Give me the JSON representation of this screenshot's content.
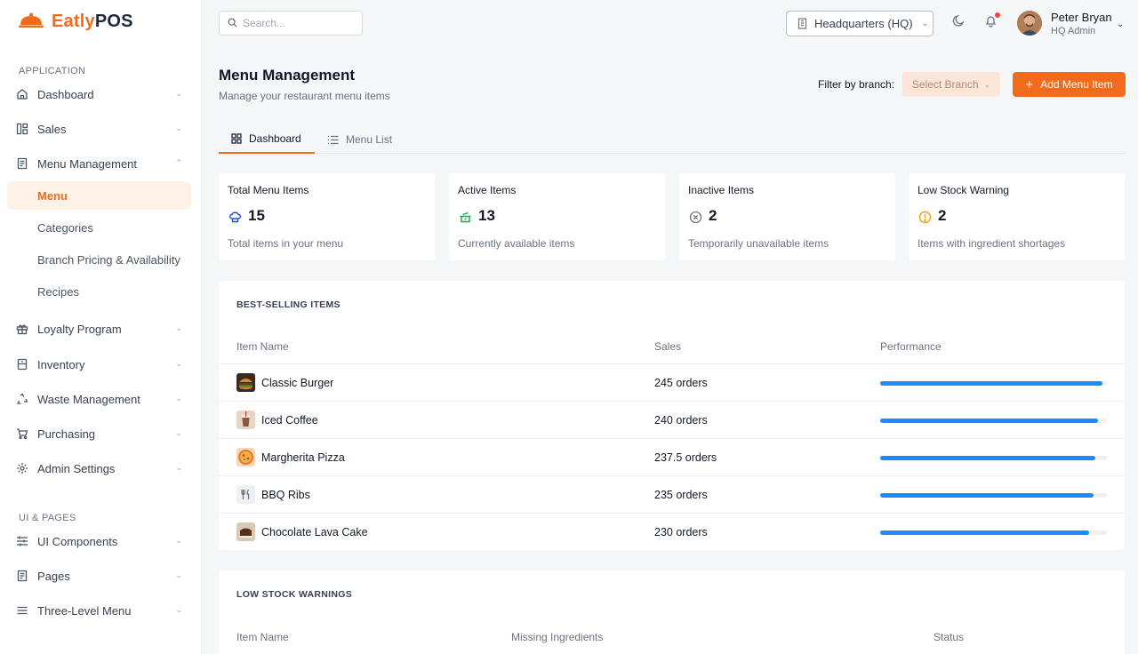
{
  "brand": {
    "name_part1": "Eatly",
    "name_part2": "POS",
    "logo_icon": "cloche-icon",
    "accent": "#f26b1d"
  },
  "sidebar": {
    "section_app": "APPLICATION",
    "section_ui": "UI & PAGES",
    "items": [
      {
        "label": "Dashboard",
        "icon": "home-icon"
      },
      {
        "label": "Sales",
        "icon": "grid-icon"
      },
      {
        "label": "Menu Management",
        "icon": "receipt-icon"
      },
      {
        "label": "Loyalty Program",
        "icon": "gift-icon"
      },
      {
        "label": "Inventory",
        "icon": "box-icon"
      },
      {
        "label": "Waste Management",
        "icon": "recycle-icon"
      },
      {
        "label": "Purchasing",
        "icon": "cart-icon"
      },
      {
        "label": "Admin Settings",
        "icon": "gear-icon"
      }
    ],
    "menu_sub": [
      {
        "label": "Menu",
        "active": true
      },
      {
        "label": "Categories"
      },
      {
        "label": "Branch Pricing & Availability"
      },
      {
        "label": "Recipes"
      }
    ],
    "ui_items": [
      {
        "label": "UI Components",
        "icon": "sliders-icon"
      },
      {
        "label": "Pages",
        "icon": "pages-icon"
      },
      {
        "label": "Three-Level Menu",
        "icon": "menu-lines-icon"
      }
    ]
  },
  "topbar": {
    "search_placeholder": "Search...",
    "branch": "Headquarters (HQ)",
    "user_name": "Peter Bryan",
    "user_role": "HQ Admin"
  },
  "page": {
    "title": "Menu Management",
    "subtitle": "Manage your restaurant menu items",
    "filter_label": "Filter by branch:",
    "filter_placeholder": "Select Branch",
    "add_button": "Add Menu Item"
  },
  "tabs": [
    {
      "label": "Dashboard",
      "active": true,
      "icon": "dashboard-icon"
    },
    {
      "label": "Menu List",
      "active": false,
      "icon": "list-icon"
    }
  ],
  "stats": [
    {
      "label": "Total Menu Items",
      "value": "15",
      "desc": "Total items in your menu",
      "icon": "chef-hat-icon",
      "color": "#1d4ed8"
    },
    {
      "label": "Active Items",
      "value": "13",
      "desc": "Currently available items",
      "icon": "pot-icon",
      "color": "#16a34a"
    },
    {
      "label": "Inactive Items",
      "value": "2",
      "desc": "Temporarily unavailable items",
      "icon": "x-circle-icon",
      "color": "#6b7280"
    },
    {
      "label": "Low Stock Warning",
      "value": "2",
      "desc": "Items with ingredient shortages",
      "icon": "alert-circle-icon",
      "color": "#f59e0b"
    }
  ],
  "best_selling": {
    "title": "BEST-SELLING ITEMS",
    "columns": [
      "Item Name",
      "Sales",
      "Performance"
    ],
    "rows": [
      {
        "name": "Classic Burger",
        "sales": "245 orders",
        "performance": 0.98,
        "thumb": "burger-thumb"
      },
      {
        "name": "Iced Coffee",
        "sales": "240 orders",
        "performance": 0.96,
        "thumb": "coffee-thumb"
      },
      {
        "name": "Margherita Pizza",
        "sales": "237.5 orders",
        "performance": 0.95,
        "thumb": "pizza-thumb"
      },
      {
        "name": "BBQ Ribs",
        "sales": "235 orders",
        "performance": 0.94,
        "thumb": "utensils-icon"
      },
      {
        "name": "Chocolate Lava Cake",
        "sales": "230 orders",
        "performance": 0.92,
        "thumb": "cake-thumb"
      }
    ]
  },
  "low_stock": {
    "title": "LOW STOCK WARNINGS",
    "columns": [
      "Item Name",
      "Missing Ingredients",
      "Status"
    ]
  }
}
